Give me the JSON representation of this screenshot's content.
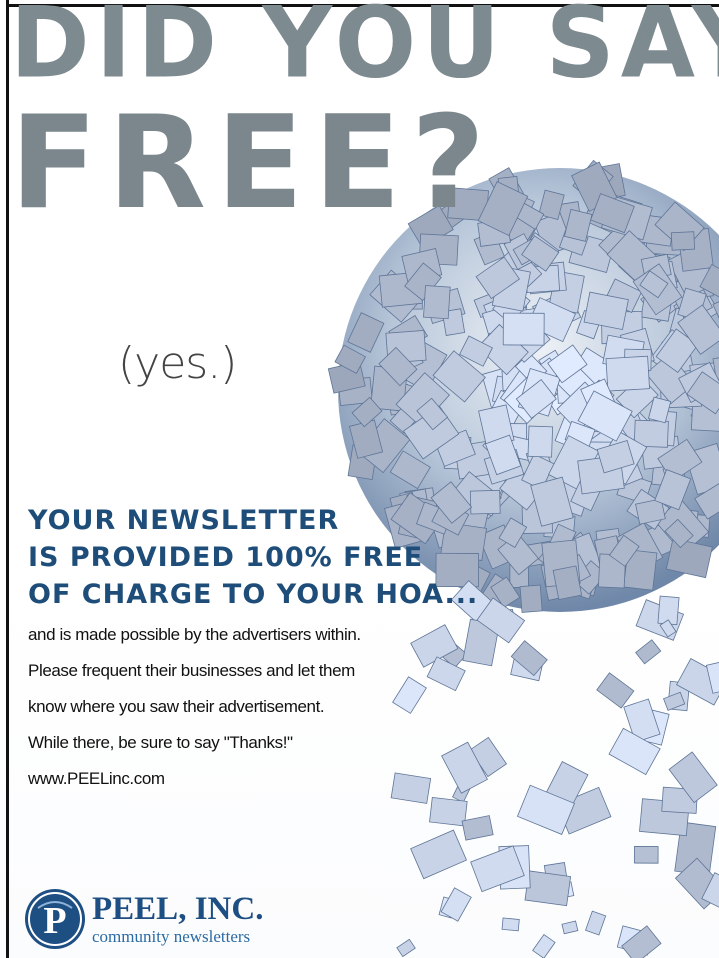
{
  "headline": {
    "line1": "DID YOU SAY",
    "line2": "FREE?"
  },
  "aside": "(yes.)",
  "subheading": {
    "line1": "YOUR NEWSLETTER",
    "line2": "IS PROVIDED 100% FREE",
    "line3": "OF CHARGE TO YOUR HOA..."
  },
  "body": [
    "and is made possible by the  advertisers within.",
    "Please frequent their businesses and let them",
    "know where you saw their advertisement.",
    "While there,  be sure to say \"Thanks!\"",
    "www.PEELinc.com"
  ],
  "logo": {
    "name": "PEEL, INC.",
    "tagline": "community newsletters",
    "mark_letter": "P"
  },
  "colors": {
    "headline": "#7d8a90",
    "subheading": "#1d4d78",
    "logo": "#1e4f83"
  }
}
